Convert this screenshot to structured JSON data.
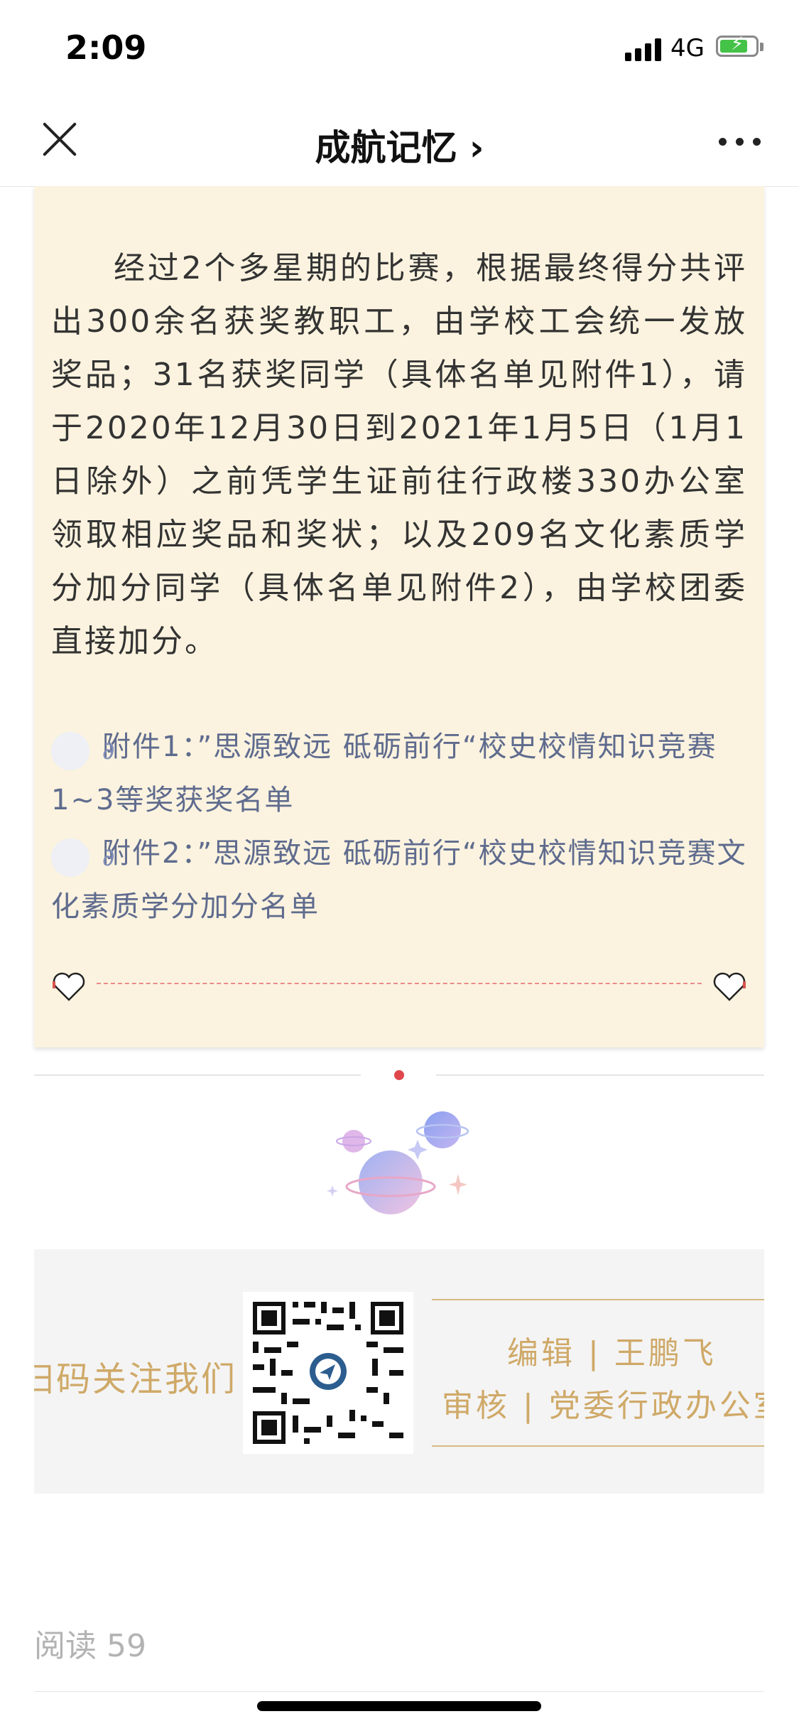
{
  "status_bar": {
    "time": "2:09",
    "network": "4G",
    "battery_level": 0.7,
    "icons": [
      "signal-icon",
      "battery-charging-icon"
    ]
  },
  "nav": {
    "title": "成航记忆",
    "title_chevron": "›",
    "icons": [
      "close-icon",
      "more-icon"
    ]
  },
  "article": {
    "paragraph": "经过2个多星期的比赛，根据最终得分共评出300余名获奖教职工，由学校工会统一发放奖品；31名获奖同学（具体名单见附件1），请于2020年12月30日到2021年1月5日（1月1日除外）之前凭学生证前往行政楼330办公室领取相应奖品和奖状；以及209名文化素质学分加分同学（具体名单见附件2），由学校团委直接加分。",
    "attachments": [
      {
        "label": "附件1：”思源致远 砥砺前行“校史校情知识竞赛1~3等奖获奖名单",
        "icon": "link-icon"
      },
      {
        "label": "附件2：”思源致远 砥砺前行“校史校情知识竞赛文化素质学分加分名单",
        "icon": "link-icon"
      }
    ],
    "colors": {
      "card_bg": "#fbf3df",
      "link": "#5f6b8e",
      "dashed": "#e98b8b",
      "gold": "#cfa968"
    }
  },
  "footer": {
    "scan_text": "扫码关注我们",
    "editor_label": "编辑",
    "editor_name": "王鹏飞",
    "reviewer_label": "审核",
    "reviewer_name": "党委行政办公室",
    "separator": "|"
  },
  "read_count": {
    "label": "阅读",
    "value": "59"
  }
}
